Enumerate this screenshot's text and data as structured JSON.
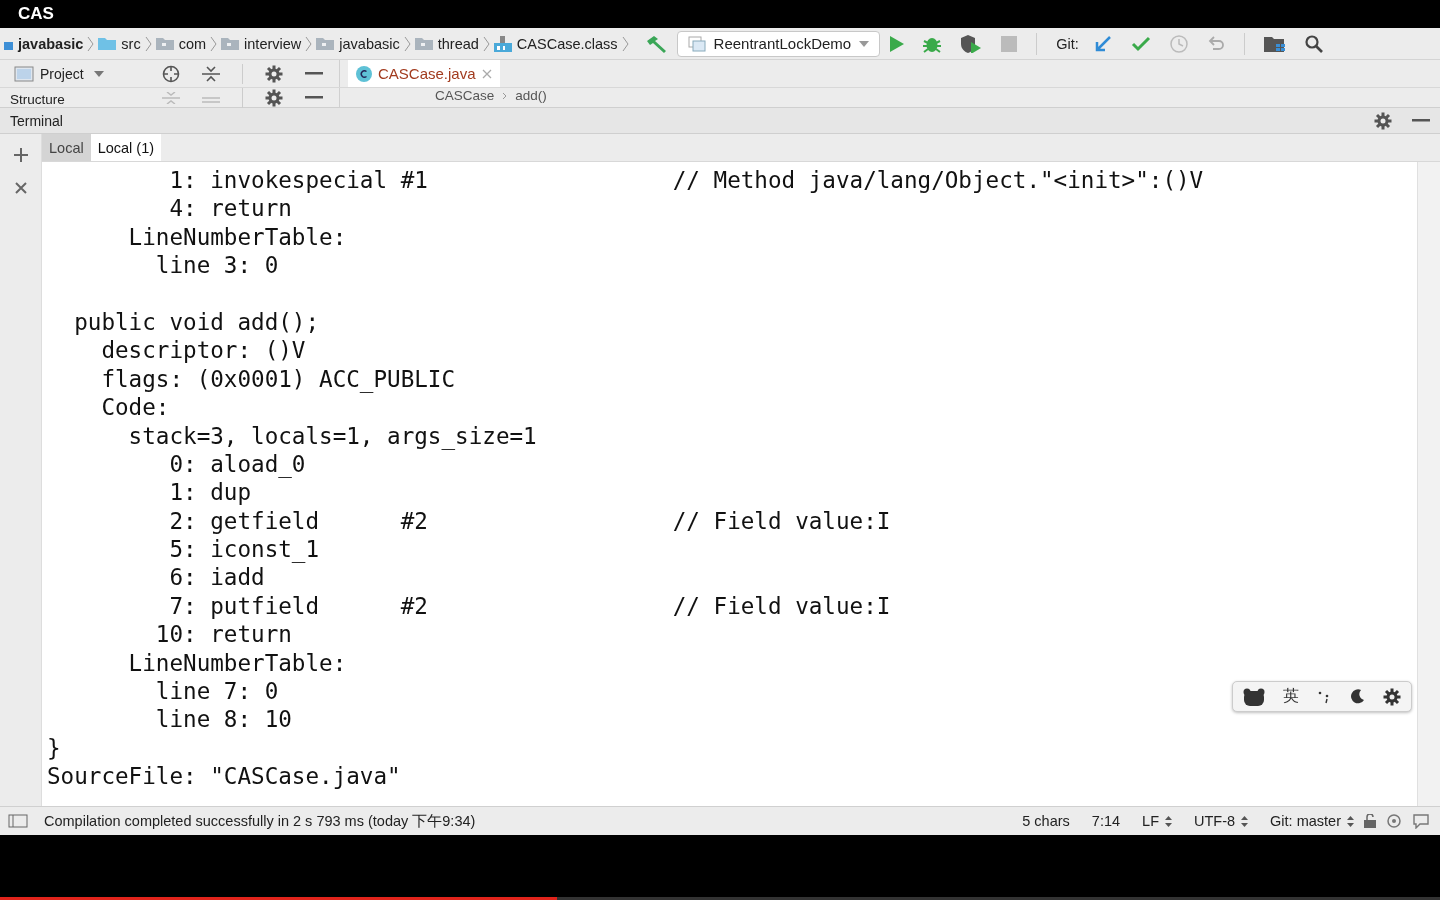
{
  "video_title": "CAS",
  "navbar": {
    "crumbs": [
      {
        "label": "javabasic",
        "kind": "module"
      },
      {
        "label": "src",
        "kind": "source"
      },
      {
        "label": "com",
        "kind": "package"
      },
      {
        "label": "interview",
        "kind": "package"
      },
      {
        "label": "javabasic",
        "kind": "package"
      },
      {
        "label": "thread",
        "kind": "package"
      },
      {
        "label": "CASCase.class",
        "kind": "class"
      }
    ],
    "run_config": "ReentrantLockDemo",
    "git_label": "Git:"
  },
  "project_panel": {
    "title": "Project"
  },
  "structure_panel": {
    "title": "Structure"
  },
  "editor": {
    "tabs": [
      {
        "label": "CASCase.java",
        "selected": true
      }
    ],
    "breadcrumb": [
      "CASCase",
      "add()"
    ]
  },
  "terminal": {
    "title": "Terminal",
    "tabs": [
      {
        "label": "Local",
        "selected": false
      },
      {
        "label": "Local (1)",
        "selected": true
      }
    ],
    "sections": [
      [
        "         1: invokespecial #1                  // Method java/lang/Object.\"<init>\":()V",
        "         4: return",
        "      LineNumberTable:",
        "        line 3: 0"
      ],
      [
        "  public void add();",
        "    descriptor: ()V",
        "    flags: (0x0001) ACC_PUBLIC",
        "    Code:",
        "      stack=3, locals=1, args_size=1",
        "         0: aload_0",
        "         1: dup",
        "         2: getfield      #2                  // Field value:I",
        "         5: iconst_1",
        "         6: iadd",
        "         7: putfield      #2                  // Field value:I",
        "        10: return",
        "      LineNumberTable:",
        "        line 7: 0",
        "        line 8: 10",
        "}",
        "SourceFile: \"CASCase.java\""
      ]
    ]
  },
  "ime_toolbar": {
    "language": "英"
  },
  "status_bar": {
    "message": "Compilation completed successfully in 2 s 793 ms (today 下午9:34)",
    "items": [
      {
        "label": "5 chars",
        "kind": "plain"
      },
      {
        "label": "7:14",
        "kind": "plain"
      },
      {
        "label": "LF",
        "kind": "select"
      },
      {
        "label": "UTF-8",
        "kind": "select"
      },
      {
        "label": "Git: master",
        "kind": "select"
      }
    ]
  },
  "video_player": {
    "level": 0.387
  }
}
